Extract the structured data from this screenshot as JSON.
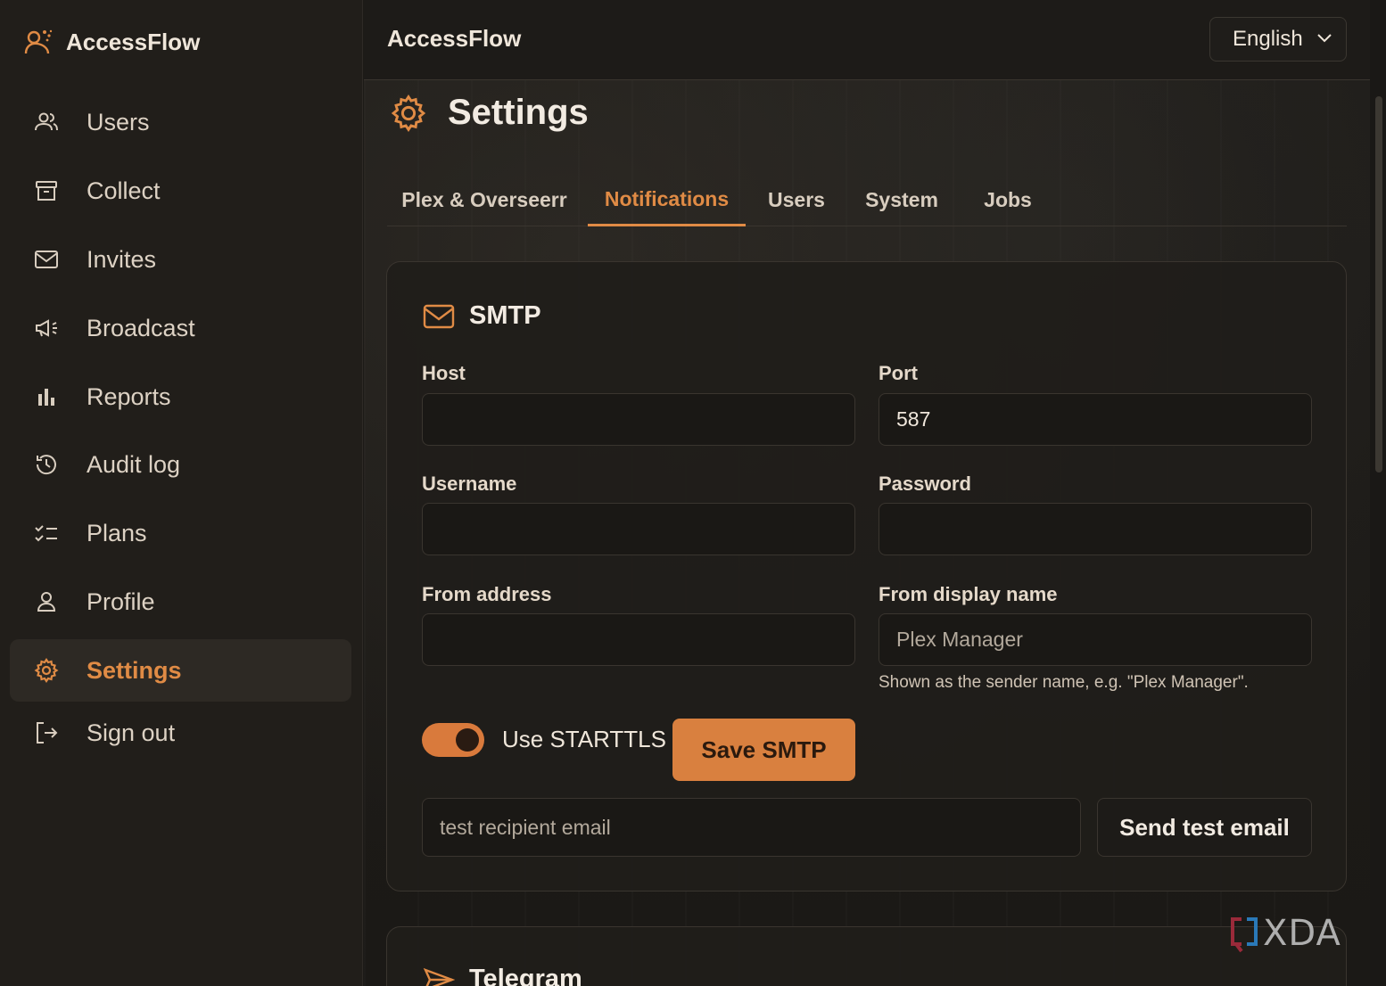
{
  "brand": {
    "name": "AccessFlow"
  },
  "sidebar": {
    "items": [
      {
        "label": "Users",
        "icon": "users-icon"
      },
      {
        "label": "Collect",
        "icon": "archive-icon"
      },
      {
        "label": "Invites",
        "icon": "mail-icon"
      },
      {
        "label": "Broadcast",
        "icon": "megaphone-icon"
      },
      {
        "label": "Reports",
        "icon": "bar-chart-icon"
      },
      {
        "label": "Audit log",
        "icon": "history-icon"
      },
      {
        "label": "Plans",
        "icon": "checklist-icon"
      },
      {
        "label": "Profile",
        "icon": "user-icon"
      },
      {
        "label": "Settings",
        "icon": "gear-icon",
        "active": true
      },
      {
        "label": "Sign out",
        "icon": "logout-icon"
      }
    ]
  },
  "header": {
    "title": "AccessFlow",
    "language": "English"
  },
  "page": {
    "title": "Settings",
    "tabs": [
      {
        "label": "Plex & Overseerr"
      },
      {
        "label": "Notifications",
        "active": true
      },
      {
        "label": "Users"
      },
      {
        "label": "System"
      },
      {
        "label": "Jobs"
      }
    ]
  },
  "smtp": {
    "title": "SMTP",
    "host_label": "Host",
    "host_value": "",
    "port_label": "Port",
    "port_value": "587",
    "username_label": "Username",
    "username_value": "",
    "password_label": "Password",
    "password_value": "",
    "from_address_label": "From address",
    "from_address_value": "",
    "from_name_label": "From display name",
    "from_name_placeholder": "Plex Manager",
    "from_name_hint": "Shown as the sender name, e.g. \"Plex Manager\".",
    "starttls_label": "Use STARTTLS",
    "starttls_enabled": true,
    "save_label": "Save SMTP",
    "test_placeholder": "test recipient email",
    "send_test_label": "Send test email"
  },
  "telegram": {
    "title": "Telegram"
  },
  "watermark": {
    "text": "XDA"
  },
  "colors": {
    "accent": "#e08b45",
    "background": "#1c1a17",
    "sidebar": "#211e1a"
  }
}
